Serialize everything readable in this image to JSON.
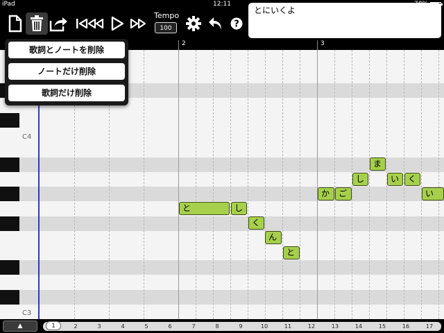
{
  "status_bar": {
    "device": "iPad",
    "time": "12:11",
    "battery": "78%",
    "battery_level": 0.78
  },
  "toolbar": {
    "buttons": [
      "new-document",
      "delete",
      "export",
      "go-to-start",
      "rewind",
      "play",
      "fast-forward",
      "settings",
      "undo",
      "help"
    ],
    "tempo_label": "Tempo",
    "tempo_value": "100",
    "lyrics_text": "とにいくよ"
  },
  "ruler": {
    "bars": [
      "2",
      "3"
    ]
  },
  "piano_roll": {
    "octave_labels": [
      "C4",
      "C3"
    ],
    "notes": [
      {
        "lyric": "と"
      },
      {
        "lyric": "し"
      },
      {
        "lyric": "く"
      },
      {
        "lyric": "ん"
      },
      {
        "lyric": "と"
      },
      {
        "lyric": "か"
      },
      {
        "lyric": "ご"
      },
      {
        "lyric": "し"
      },
      {
        "lyric": "ま"
      },
      {
        "lyric": "い"
      },
      {
        "lyric": "く"
      },
      {
        "lyric": "い"
      }
    ]
  },
  "delete_menu": {
    "items": [
      "歌詞とノートを削除",
      "ノートだけ削除",
      "歌詞だけ削除"
    ]
  },
  "bottom_bar": {
    "scroll_up_label": "▲",
    "current_bar": "1",
    "bar_ticks": [
      "2",
      "3",
      "4",
      "5",
      "6",
      "7",
      "8",
      "9",
      "10",
      "11",
      "12",
      "13",
      "14",
      "15",
      "16",
      "17"
    ]
  }
}
